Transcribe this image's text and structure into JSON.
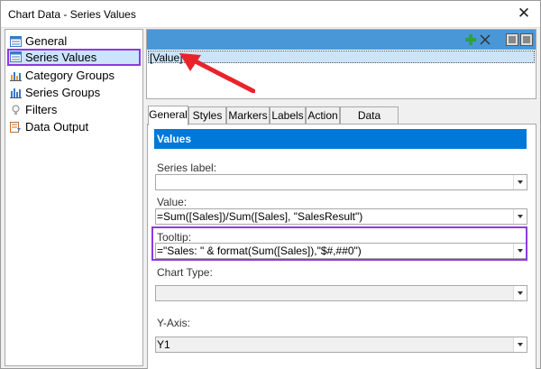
{
  "window": {
    "title": "Chart Data - Series Values"
  },
  "nav": {
    "items": [
      {
        "label": "General",
        "icon": "general-icon"
      },
      {
        "label": "Series Values",
        "icon": "series-values-icon",
        "selected": true
      },
      {
        "label": "Category Groups",
        "icon": "category-groups-icon"
      },
      {
        "label": "Series Groups",
        "icon": "series-groups-icon"
      },
      {
        "label": "Filters",
        "icon": "filter-icon"
      },
      {
        "label": "Data Output",
        "icon": "data-output-icon"
      }
    ]
  },
  "list": {
    "row_value": "[Value]"
  },
  "tabs": [
    "General",
    "Styles",
    "Markers",
    "Labels",
    "Action",
    "Data Output"
  ],
  "form": {
    "section_title": "Values",
    "series_label": {
      "label": "Series label:",
      "value": ""
    },
    "value": {
      "label": "Value:",
      "value": "=Sum([Sales])/Sum([Sales], \"SalesResult\")"
    },
    "tooltip": {
      "label": "Tooltip:",
      "value": "=\"Sales: \" & format(Sum([Sales]),\"$#,##0\")"
    },
    "chart_type": {
      "label": "Chart Type:",
      "value": ""
    },
    "y_axis": {
      "label": "Y-Axis:",
      "value": "Y1"
    }
  },
  "colors": {
    "accent": "#0078d7",
    "toolbar": "#4a97d8",
    "highlight": "#8a3be0",
    "arrow": "#e8232b"
  }
}
